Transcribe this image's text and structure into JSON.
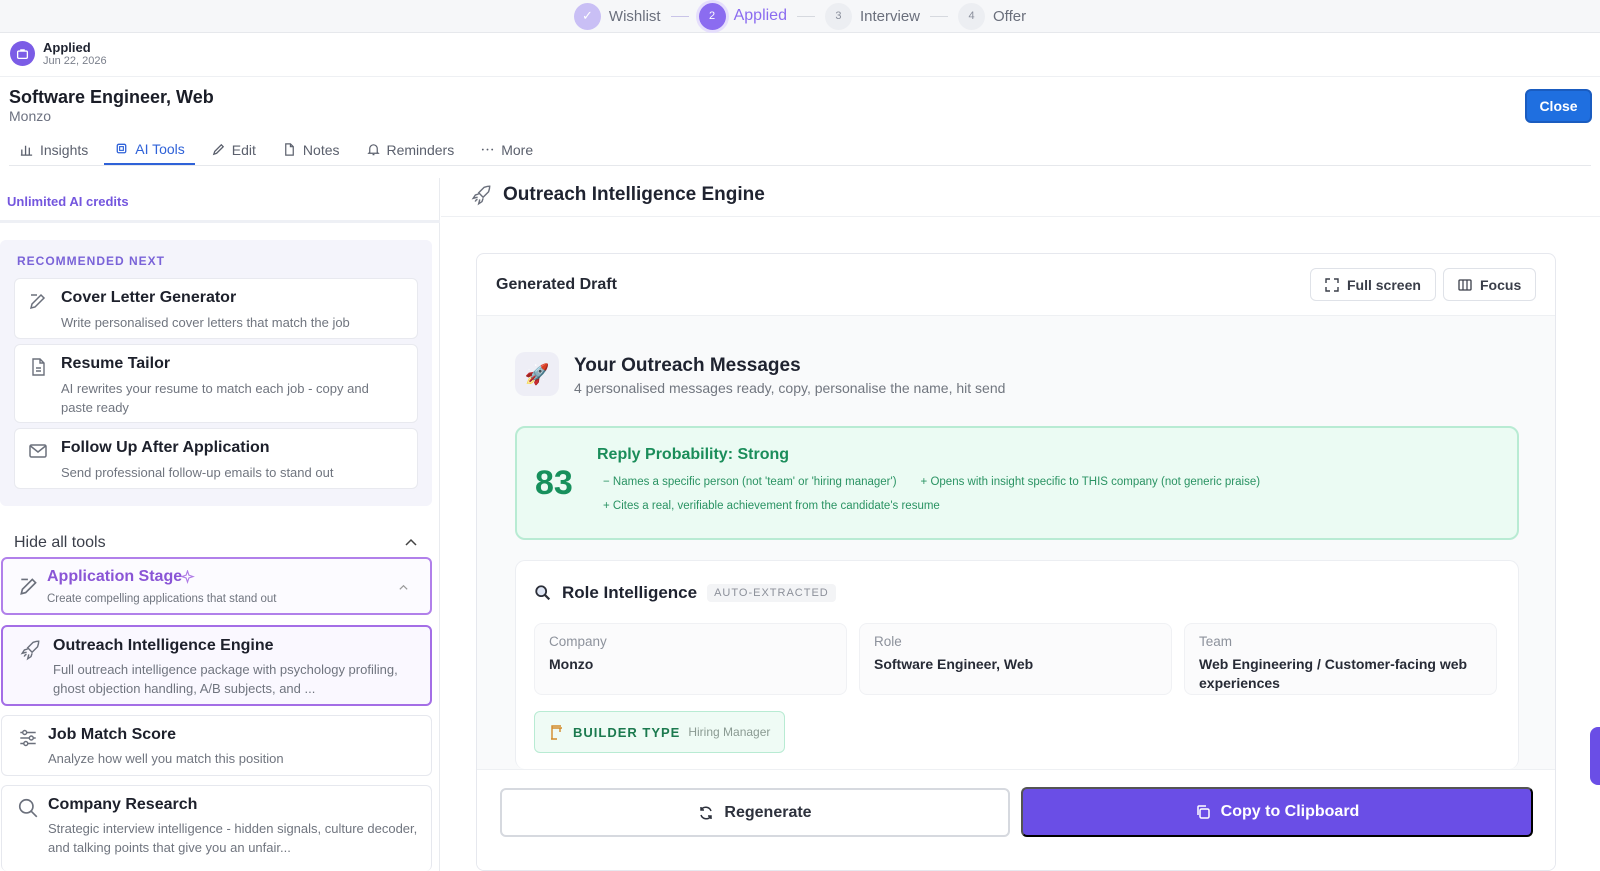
{
  "stepper": {
    "steps": [
      {
        "num": "✓",
        "label": "Wishlist"
      },
      {
        "num": "2",
        "label": "Applied"
      },
      {
        "num": "3",
        "label": "Interview"
      },
      {
        "num": "4",
        "label": "Offer"
      }
    ]
  },
  "status": {
    "label": "Applied",
    "date": "Jun 22, 2026"
  },
  "job": {
    "title": "Software Engineer, Web",
    "company": "Monzo",
    "close_label": "Close"
  },
  "tabs": [
    {
      "label": "Insights",
      "icon": "bar-chart-icon"
    },
    {
      "label": "AI Tools",
      "icon": "chip-icon"
    },
    {
      "label": "Edit",
      "icon": "pencil-icon"
    },
    {
      "label": "Notes",
      "icon": "document-icon"
    },
    {
      "label": "Reminders",
      "icon": "bell-icon"
    },
    {
      "label": "More",
      "icon": "ellipsis-icon"
    }
  ],
  "sidebar": {
    "credits": "Unlimited AI credits",
    "recommended_heading": "RECOMMENDED NEXT",
    "recommended": [
      {
        "title": "Cover Letter Generator",
        "desc": "Write personalised cover letters that match the job"
      },
      {
        "title": "Resume Tailor",
        "desc": "AI rewrites your resume to match each job - copy and paste ready"
      },
      {
        "title": "Follow Up After Application",
        "desc": "Send professional follow-up emails to stand out"
      }
    ],
    "hide_label": "Hide all tools",
    "stage": {
      "title": "Application Stage",
      "desc": "Create compelling applications that stand out"
    },
    "tools": [
      {
        "title": "Outreach Intelligence Engine",
        "desc": "Full outreach intelligence package with psychology profiling, ghost objection handling, A/B subjects, and ..."
      },
      {
        "title": "Job Match Score",
        "desc": "Analyze how well you match this position"
      },
      {
        "title": "Company Research",
        "desc": "Strategic interview intelligence - hidden signals, culture decoder, and talking points that give you an unfair..."
      }
    ]
  },
  "main": {
    "title": "Outreach Intelligence Engine",
    "draft_title": "Generated Draft",
    "fullscreen_label": "Full screen",
    "focus_label": "Focus",
    "messages_title": "Your Outreach Messages",
    "messages_sub": "4 personalised messages ready, copy, personalise the name, hit send",
    "score": {
      "value": "83",
      "label": "Reply Probability: Strong",
      "chips": [
        "− Names a specific person (not 'team' or 'hiring manager')",
        "+ Opens with insight specific to THIS company (not generic praise)",
        "+ Cites a real, verifiable achievement from the candidate's resume"
      ]
    },
    "role": {
      "title": "Role Intelligence",
      "tag": "AUTO-EXTRACTED",
      "fields": [
        {
          "key": "Company",
          "value": "Monzo"
        },
        {
          "key": "Role",
          "value": "Software Engineer, Web"
        },
        {
          "key": "Team",
          "value": "Web Engineering / Customer-facing web experiences"
        }
      ],
      "builder_label": "BUILDER TYPE",
      "builder_sub": "Hiring Manager"
    },
    "regenerate_label": "Regenerate",
    "copy_label": "Copy to Clipboard"
  },
  "colors": {
    "accent": "#6a4ee6",
    "primary_blue": "#1f6fe0",
    "success": "#17905c"
  }
}
